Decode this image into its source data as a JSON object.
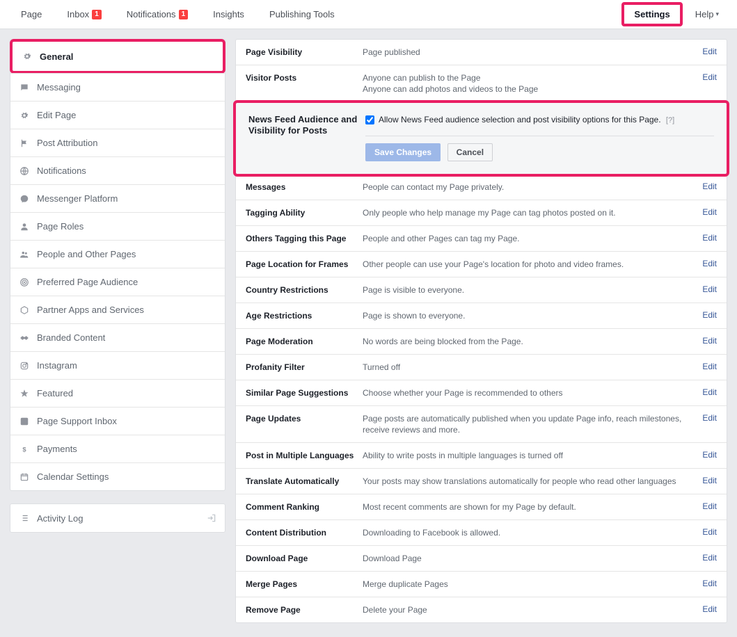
{
  "topnav": {
    "page": "Page",
    "inbox": "Inbox",
    "inbox_badge": "1",
    "notifications": "Notifications",
    "notifications_badge": "1",
    "insights": "Insights",
    "publishing": "Publishing Tools",
    "settings": "Settings",
    "help": "Help"
  },
  "sidebar": {
    "items": [
      {
        "label": "General"
      },
      {
        "label": "Messaging"
      },
      {
        "label": "Edit Page"
      },
      {
        "label": "Post Attribution"
      },
      {
        "label": "Notifications"
      },
      {
        "label": "Messenger Platform"
      },
      {
        "label": "Page Roles"
      },
      {
        "label": "People and Other Pages"
      },
      {
        "label": "Preferred Page Audience"
      },
      {
        "label": "Partner Apps and Services"
      },
      {
        "label": "Branded Content"
      },
      {
        "label": "Instagram"
      },
      {
        "label": "Featured"
      },
      {
        "label": "Page Support Inbox"
      },
      {
        "label": "Payments"
      },
      {
        "label": "Calendar Settings"
      }
    ],
    "activity": "Activity Log"
  },
  "settings": {
    "edit": "Edit",
    "rows": [
      {
        "label": "Page Visibility",
        "value": "Page published"
      },
      {
        "label": "Visitor Posts",
        "value": "Anyone can publish to the Page",
        "value2": "Anyone can add photos and videos to the Page"
      },
      {
        "label": "News Feed Audience and Visibility for Posts",
        "checkbox": "Allow News Feed audience selection and post visibility options for this Page.",
        "help": "[?]",
        "save": "Save Changes",
        "cancel": "Cancel"
      },
      {
        "label": "Messages",
        "value": "People can contact my Page privately."
      },
      {
        "label": "Tagging Ability",
        "value": "Only people who help manage my Page can tag photos posted on it."
      },
      {
        "label": "Others Tagging this Page",
        "value": "People and other Pages can tag my Page."
      },
      {
        "label": "Page Location for Frames",
        "value": "Other people can use your Page's location for photo and video frames."
      },
      {
        "label": "Country Restrictions",
        "value": "Page is visible to everyone."
      },
      {
        "label": "Age Restrictions",
        "value": "Page is shown to everyone."
      },
      {
        "label": "Page Moderation",
        "value": "No words are being blocked from the Page."
      },
      {
        "label": "Profanity Filter",
        "value": "Turned off"
      },
      {
        "label": "Similar Page Suggestions",
        "value": "Choose whether your Page is recommended to others"
      },
      {
        "label": "Page Updates",
        "value": "Page posts are automatically published when you update Page info, reach milestones, receive reviews and more."
      },
      {
        "label": "Post in Multiple Languages",
        "value": "Ability to write posts in multiple languages is turned off"
      },
      {
        "label": "Translate Automatically",
        "value": "Your posts may show translations automatically for people who read other languages"
      },
      {
        "label": "Comment Ranking",
        "value": "Most recent comments are shown for my Page by default."
      },
      {
        "label": "Content Distribution",
        "value": "Downloading to Facebook is allowed."
      },
      {
        "label": "Download Page",
        "value": "Download Page"
      },
      {
        "label": "Merge Pages",
        "value": "Merge duplicate Pages"
      },
      {
        "label": "Remove Page",
        "value": "Delete your Page"
      }
    ]
  }
}
